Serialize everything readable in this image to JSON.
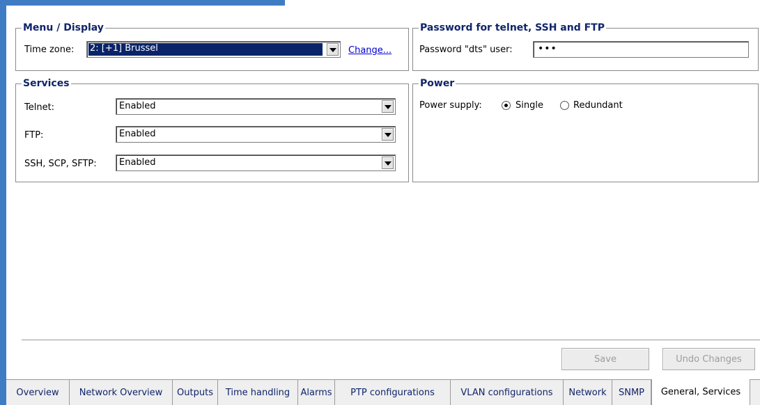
{
  "menu_display": {
    "title": "Menu / Display",
    "timezone_label": "Time zone:",
    "timezone_value": "2: [+1] Brussel",
    "change_link": "Change..."
  },
  "password": {
    "title": "Password for telnet, SSH and FTP",
    "label": "Password \"dts\" user:",
    "value": "•••"
  },
  "services": {
    "title": "Services",
    "rows": [
      {
        "label": "Telnet:",
        "value": "Enabled"
      },
      {
        "label": "FTP:",
        "value": "Enabled"
      },
      {
        "label": "SSH, SCP, SFTP:",
        "value": "Enabled"
      }
    ]
  },
  "power": {
    "title": "Power",
    "supply_label": "Power supply:",
    "options": [
      "Single",
      "Redundant"
    ],
    "selected": "Single"
  },
  "actions": {
    "save": "Save",
    "undo": "Undo Changes"
  },
  "tabs": [
    "Overview",
    "Network Overview",
    "Outputs",
    "Time handling",
    "Alarms",
    "PTP configurations",
    "VLAN configurations",
    "Network",
    "SNMP",
    "General, Services"
  ],
  "active_tab": "General, Services"
}
